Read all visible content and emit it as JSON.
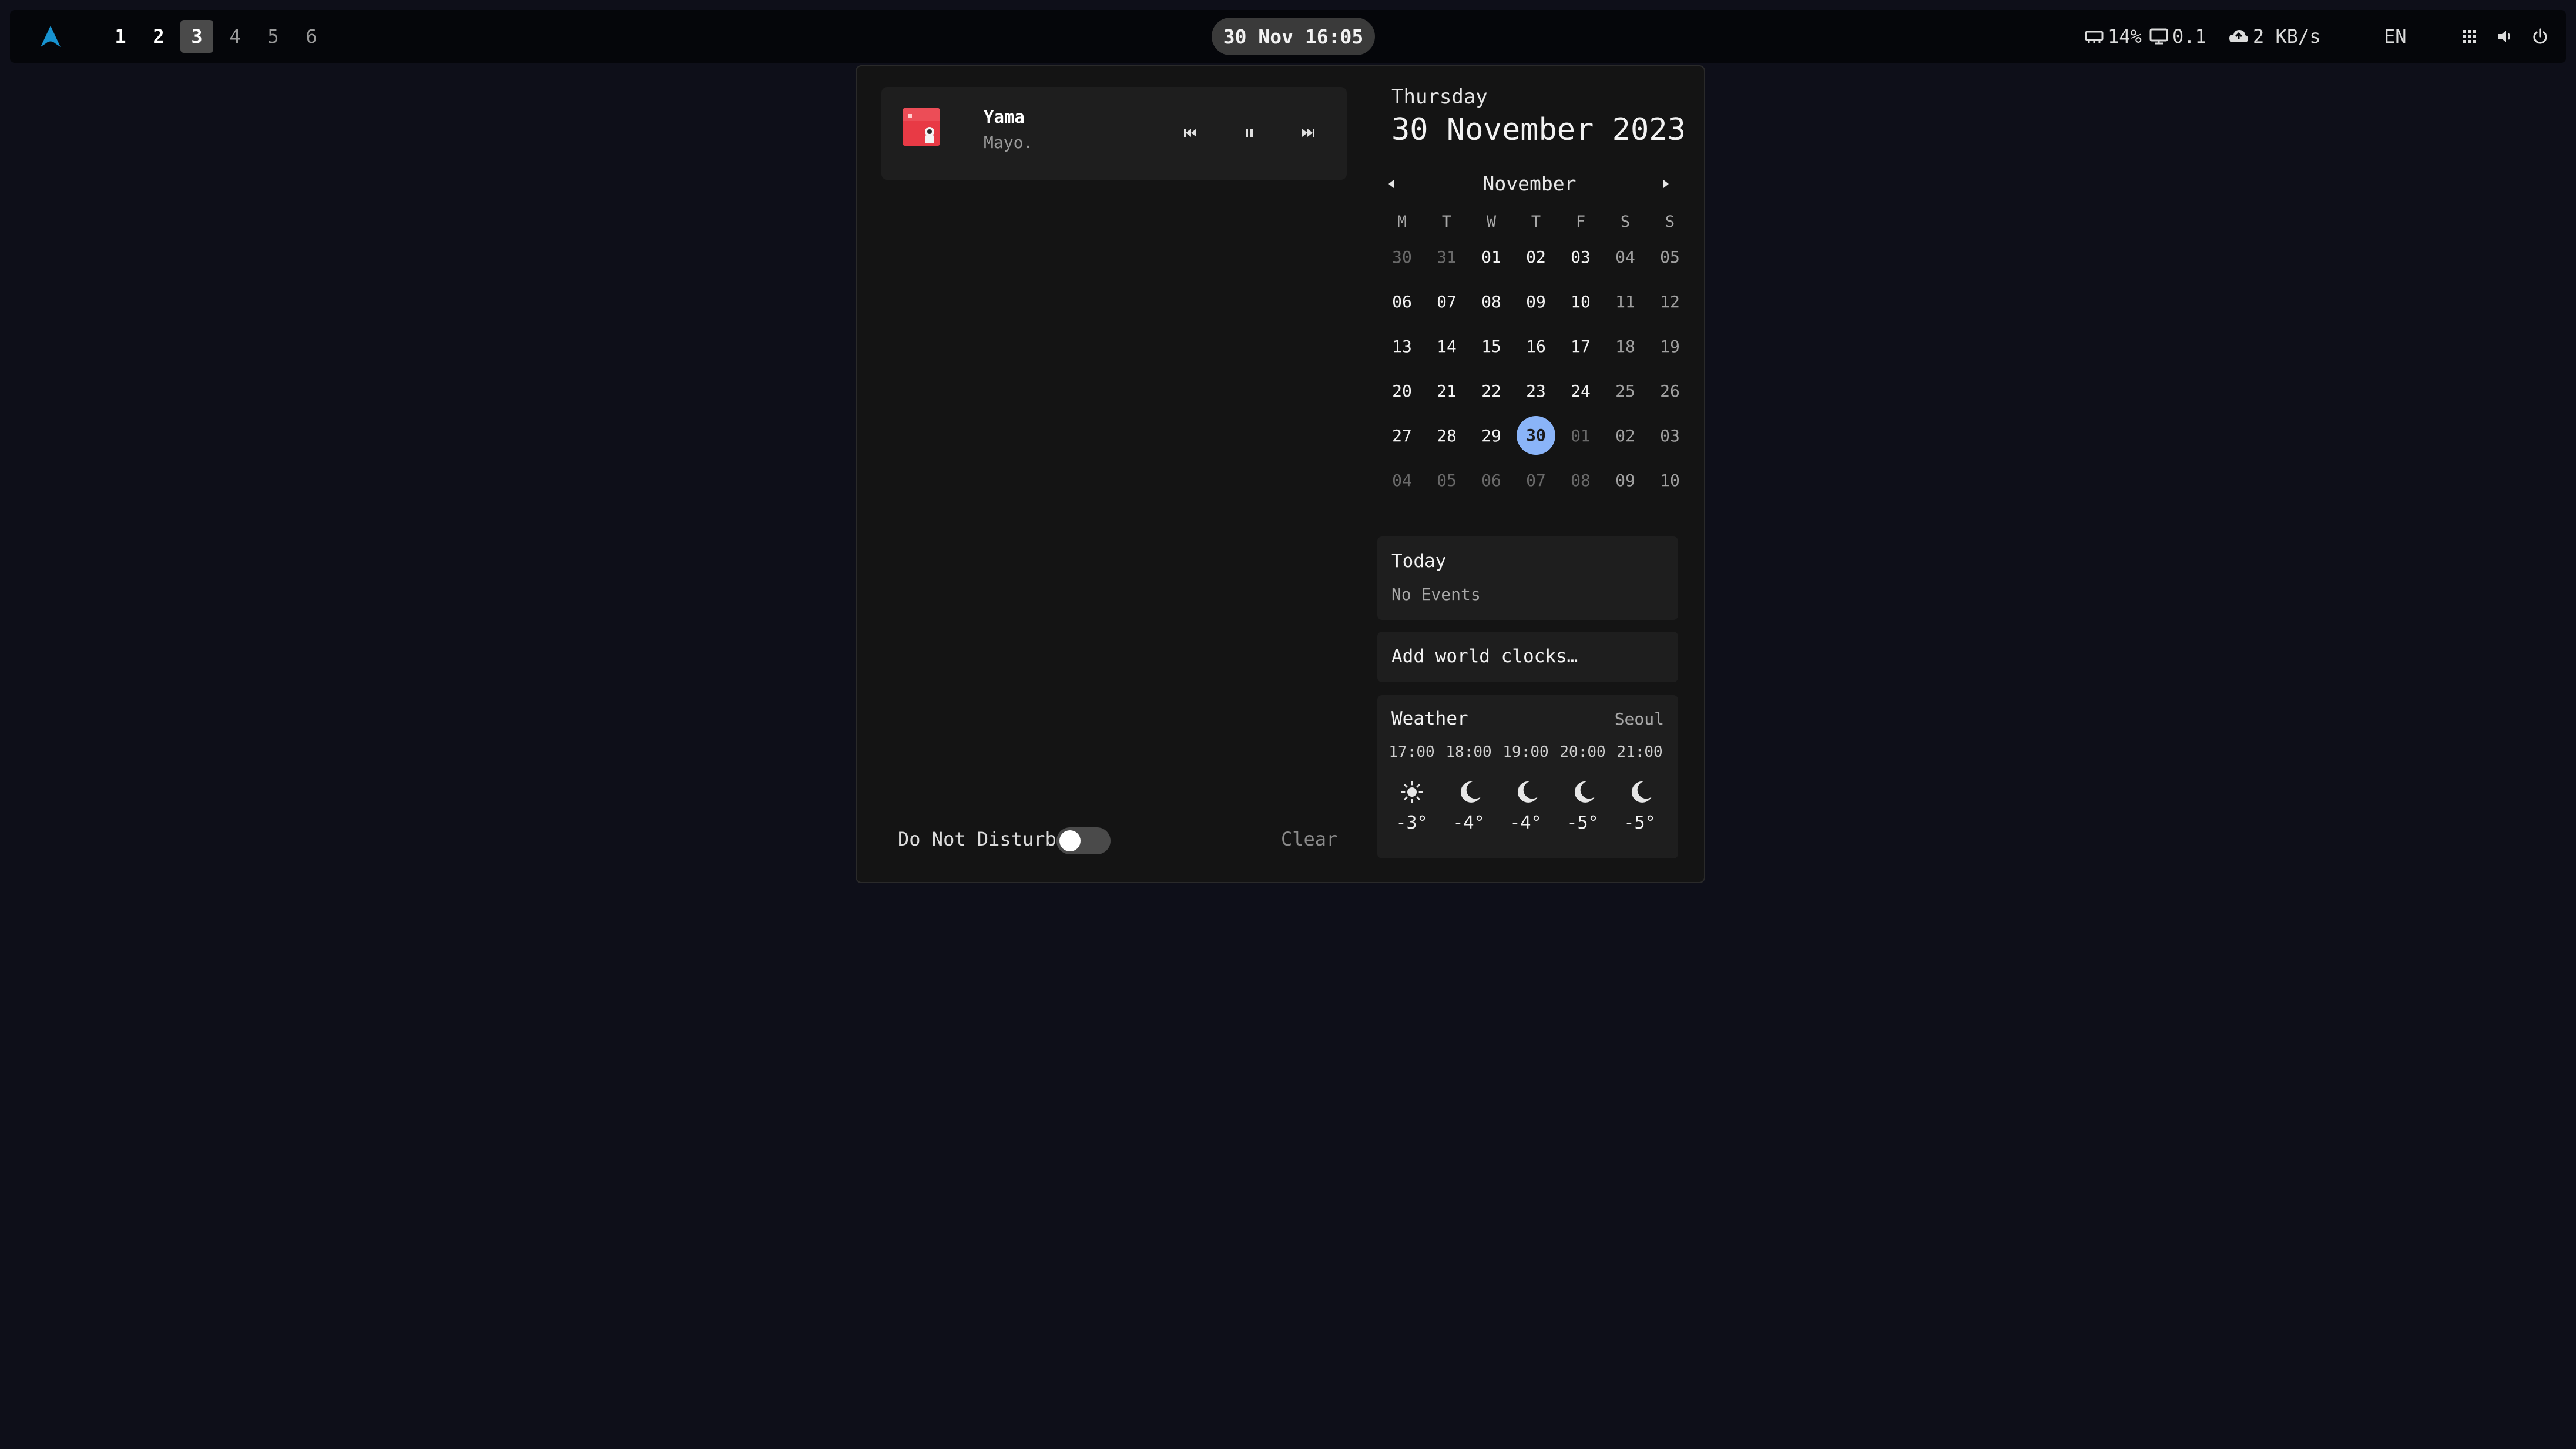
{
  "topbar": {
    "workspaces": [
      {
        "label": "1",
        "state": "occupied"
      },
      {
        "label": "2",
        "state": "occupied"
      },
      {
        "label": "3",
        "state": "active"
      },
      {
        "label": "4",
        "state": "empty"
      },
      {
        "label": "5",
        "state": "empty"
      },
      {
        "label": "6",
        "state": "empty"
      }
    ],
    "clock": "30 Nov 16:05",
    "memory": "14%",
    "cpu_load": "0.1",
    "network": "2 KB/s",
    "language": "EN",
    "icons": [
      "arch-logo-icon",
      "memory-icon",
      "monitor-icon",
      "cloud-icon",
      "apps-grid-icon",
      "volume-icon",
      "power-icon"
    ],
    "accent_color": "#1793d1"
  },
  "media": {
    "title": "Yama",
    "artist": "Mayo.",
    "icons": [
      "previous-track-icon",
      "pause-icon",
      "next-track-icon"
    ]
  },
  "notifications": {
    "dnd_label": "Do Not Disturb",
    "dnd_enabled": false,
    "clear_label": "Clear"
  },
  "calendar": {
    "day_name": "Thursday",
    "full_date": "30 November 2023",
    "month_label": "November",
    "weekdays": [
      "M",
      "T",
      "W",
      "T",
      "F",
      "S",
      "S"
    ],
    "weeks": [
      [
        {
          "d": "30",
          "t": "dim"
        },
        {
          "d": "31",
          "t": "dim"
        },
        {
          "d": "01",
          "t": "cur"
        },
        {
          "d": "02",
          "t": "cur"
        },
        {
          "d": "03",
          "t": "cur"
        },
        {
          "d": "04",
          "t": "wk"
        },
        {
          "d": "05",
          "t": "wk"
        }
      ],
      [
        {
          "d": "06",
          "t": "cur"
        },
        {
          "d": "07",
          "t": "cur"
        },
        {
          "d": "08",
          "t": "cur"
        },
        {
          "d": "09",
          "t": "cur"
        },
        {
          "d": "10",
          "t": "cur"
        },
        {
          "d": "11",
          "t": "wk"
        },
        {
          "d": "12",
          "t": "wk"
        }
      ],
      [
        {
          "d": "13",
          "t": "cur"
        },
        {
          "d": "14",
          "t": "cur"
        },
        {
          "d": "15",
          "t": "cur"
        },
        {
          "d": "16",
          "t": "cur"
        },
        {
          "d": "17",
          "t": "cur"
        },
        {
          "d": "18",
          "t": "wk"
        },
        {
          "d": "19",
          "t": "wk"
        }
      ],
      [
        {
          "d": "20",
          "t": "cur"
        },
        {
          "d": "21",
          "t": "cur"
        },
        {
          "d": "22",
          "t": "cur"
        },
        {
          "d": "23",
          "t": "cur"
        },
        {
          "d": "24",
          "t": "cur"
        },
        {
          "d": "25",
          "t": "wk"
        },
        {
          "d": "26",
          "t": "wk"
        }
      ],
      [
        {
          "d": "27",
          "t": "cur"
        },
        {
          "d": "28",
          "t": "cur"
        },
        {
          "d": "29",
          "t": "cur"
        },
        {
          "d": "30",
          "t": "today"
        },
        {
          "d": "01",
          "t": "dim"
        },
        {
          "d": "02",
          "t": "wk"
        },
        {
          "d": "03",
          "t": "wk"
        }
      ],
      [
        {
          "d": "04",
          "t": "dim"
        },
        {
          "d": "05",
          "t": "dim"
        },
        {
          "d": "06",
          "t": "dim"
        },
        {
          "d": "07",
          "t": "dim"
        },
        {
          "d": "08",
          "t": "dim"
        },
        {
          "d": "09",
          "t": "wk"
        },
        {
          "d": "10",
          "t": "wk"
        }
      ]
    ],
    "today_color": "#8ab4f8"
  },
  "events": {
    "title": "Today",
    "empty_text": "No Events"
  },
  "world_clocks": {
    "label": "Add world clocks…"
  },
  "weather": {
    "title": "Weather",
    "city": "Seoul",
    "forecast": [
      {
        "time": "17:00",
        "icon": "sun-icon",
        "temp": "-3°"
      },
      {
        "time": "18:00",
        "icon": "moon-icon",
        "temp": "-4°"
      },
      {
        "time": "19:00",
        "icon": "moon-icon",
        "temp": "-4°"
      },
      {
        "time": "20:00",
        "icon": "moon-icon",
        "temp": "-5°"
      },
      {
        "time": "21:00",
        "icon": "moon-icon",
        "temp": "-5°"
      }
    ]
  }
}
